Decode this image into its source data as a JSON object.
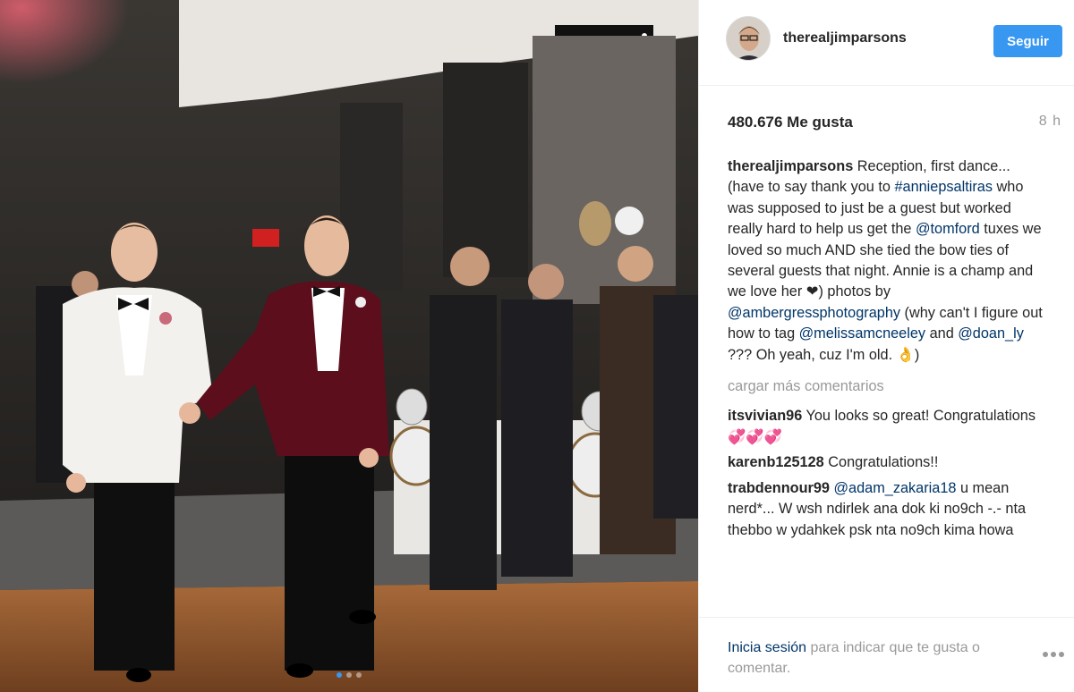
{
  "post": {
    "username": "therealjimparsons",
    "follow_label": "Seguir",
    "likes": "480.676 Me gusta",
    "time_ago": "8 h",
    "caption": {
      "author": "therealjimparsons",
      "p1": " Reception, first dance... (have to say thank you to ",
      "m1": "#anniepsaltiras",
      "p2": " who was supposed to just be a guest but worked really hard to help us get the ",
      "m2": "@tomford",
      "p3": " tuxes we loved so much AND she tied the bow ties of several guests that night. Annie is a champ and we love her ",
      "heart": "❤",
      "p4": ") photos by ",
      "m3": "@ambergressphotography",
      "p5": " (why can't I figure out how to tag ",
      "m4": "@melissamcneeley",
      "p6": " and ",
      "m5": "@doan_ly",
      "p7": " ??? Oh yeah, cuz I'm old. ",
      "emoji": "👌",
      "p8": ")"
    },
    "load_more_label": "cargar más comentarios",
    "comments": [
      {
        "author": "itsvivian96",
        "text": " You looks so great! Congratulations ",
        "emoji": "💞💞💞"
      },
      {
        "author": "karenb125128",
        "text": " Congratulations!!"
      },
      {
        "author": "trabdennour99",
        "mention": "@adam_zakaria18",
        "text": " u mean nerd*... W wsh ndirlek ana dok ki no9ch -.- nta thebbo w ydahkek psk nta no9ch kima howa"
      }
    ],
    "footer": {
      "login_link": "Inicia sesión",
      "login_text": " para indicar que te gusta o comentar."
    },
    "carousel": {
      "total": 3,
      "active": 1
    },
    "colors": {
      "accent": "#3897f0",
      "link": "#003569",
      "muted": "#999999"
    }
  }
}
